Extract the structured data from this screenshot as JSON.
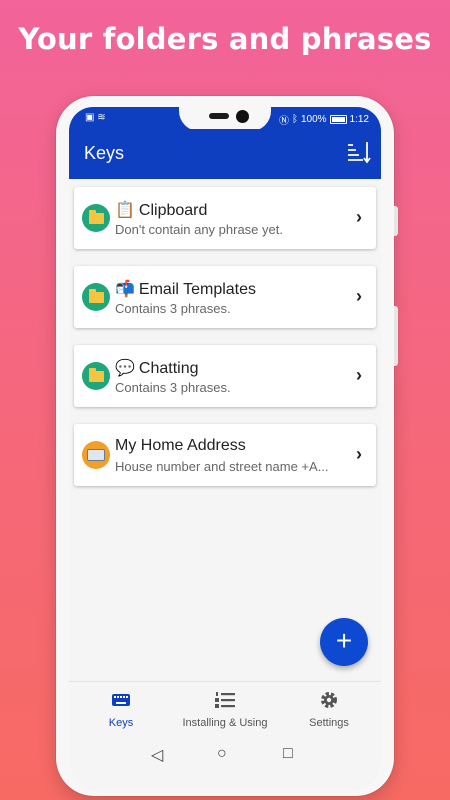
{
  "headline": "Your folders and phrases",
  "status_bar": {
    "battery": "100%",
    "time": "1:12"
  },
  "app_bar": {
    "title": "Keys",
    "action_icon": "sort-icon"
  },
  "items": [
    {
      "emoji": "📋",
      "title": "Clipboard",
      "subtitle": "Don't contain any phrase yet.",
      "icon": "folder-icon"
    },
    {
      "emoji": "📬",
      "title": "Email Templates",
      "subtitle": "Contains 3 phrases.",
      "icon": "folder-icon"
    },
    {
      "emoji": "💬",
      "title": "Chatting",
      "subtitle": "Contains 3 phrases.",
      "icon": "folder-icon"
    },
    {
      "emoji": "",
      "title": "My Home Address",
      "subtitle": "House number and street name +A...",
      "icon": "keyboard-icon"
    }
  ],
  "fab": {
    "label": "+"
  },
  "bottom_nav": [
    {
      "label": "Keys",
      "icon": "keyboard-icon",
      "active": true
    },
    {
      "label": "Installing & Using",
      "icon": "numbered-list-icon",
      "active": false
    },
    {
      "label": "Settings",
      "icon": "gear-icon",
      "active": false
    }
  ],
  "colors": {
    "primary": "#0d3fc0",
    "accent_green": "#1fa67a",
    "accent_orange": "#f0a028",
    "background_top": "#f2649a",
    "background_bottom": "#f76a63"
  }
}
